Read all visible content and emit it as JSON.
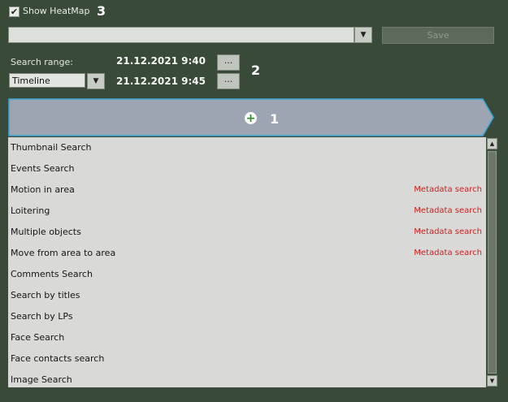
{
  "heatmap": {
    "checked_glyph": "✔",
    "label": "Show HeatMap",
    "marker": "3"
  },
  "toolbar": {
    "save_label": "Save"
  },
  "range": {
    "label": "Search range:",
    "from": "21.12.2021  9:40",
    "to": "21.12.2021  9:45",
    "dots": "...",
    "marker": "2",
    "mode": "Timeline"
  },
  "banner": {
    "marker": "1",
    "icon": "plus-icon"
  },
  "list": {
    "items": [
      {
        "label": "Thumbnail Search",
        "tag": ""
      },
      {
        "label": "Events Search",
        "tag": ""
      },
      {
        "label": "Motion in area",
        "tag": "Metadata search"
      },
      {
        "label": "Loitering",
        "tag": "Metadata search"
      },
      {
        "label": "Multiple objects",
        "tag": "Metadata search"
      },
      {
        "label": "Move from area to area",
        "tag": "Metadata search"
      },
      {
        "label": "Comments Search",
        "tag": ""
      },
      {
        "label": "Search by titles",
        "tag": ""
      },
      {
        "label": "Search by LPs",
        "tag": ""
      },
      {
        "label": "Face Search",
        "tag": ""
      },
      {
        "label": "Face contacts search",
        "tag": ""
      },
      {
        "label": "Image Search",
        "tag": ""
      }
    ]
  },
  "colors": {
    "background": "#3a4a39",
    "banner": "#9ea5b2",
    "banner_border": "#3aa7d8",
    "tag": "#cc1e1e"
  }
}
